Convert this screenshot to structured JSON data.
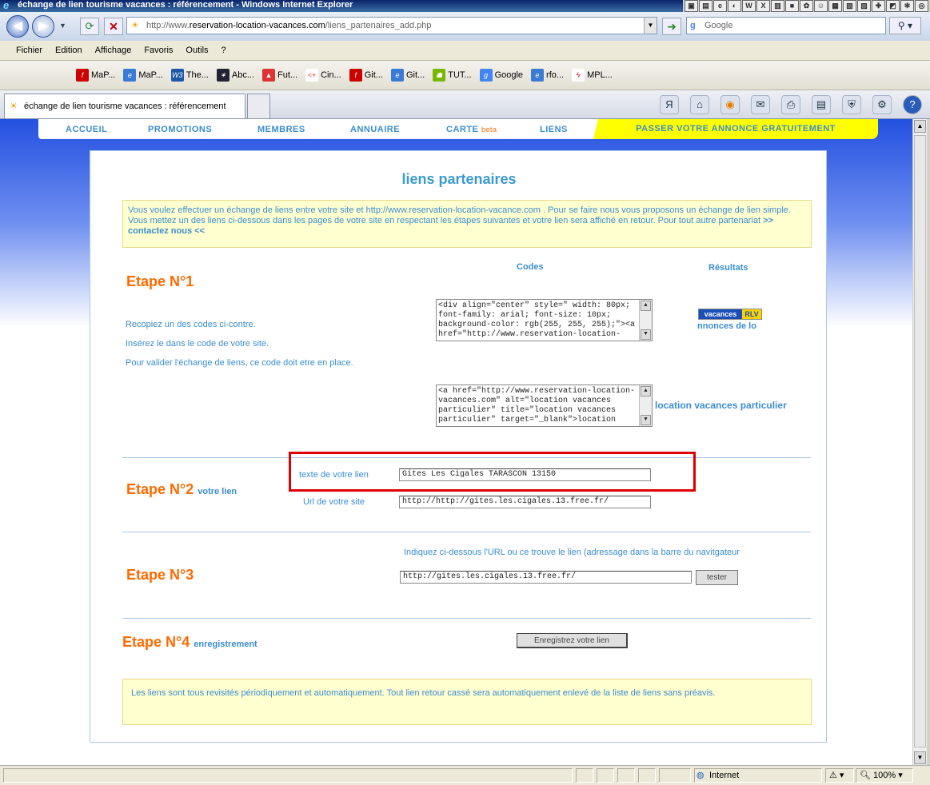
{
  "window": {
    "title": "échange de lien tourisme vacances : référencement - Windows Internet Explorer"
  },
  "address": {
    "prefix": "http://www.",
    "domain": "reservation-location-vacances.com",
    "path": "/liens_partenaires_add.php",
    "search_placeholder": "Google"
  },
  "menu": [
    "Fichier",
    "Edition",
    "Affichage",
    "Favoris",
    "Outils",
    "?"
  ],
  "favorites": [
    "MaP...",
    "MaP...",
    "The...",
    "Abc...",
    "Fut...",
    "Cin...",
    "Git...",
    "Git...",
    "TUT...",
    "Google",
    "rfo...",
    "MPL..."
  ],
  "tab": {
    "title": "échange de lien tourisme vacances : référencement"
  },
  "sitenav": {
    "items": [
      "ACCUEIL",
      "PROMOTIONS",
      "MEMBRES",
      "ANNUAIRE",
      "CARTE",
      "LIENS"
    ],
    "carte_beta": "beta",
    "cta": "PASSER VOTRE ANNONCE GRATUITEMENT"
  },
  "main": {
    "title": "liens partenaires",
    "intro": "Vous voulez effectuer un échange de liens entre votre site et http://www.reservation-location-vacance.com . Pour se faire nous vous proposons un échange de lien simple. Vous mettez un des liens ci-dessous dans les pages de votre site en respectant les étapes suivantes et votre lien sera affiché en retour. Pour tout autre partenariat",
    "intro_link": ">> contactez nous <<",
    "codes_header": "Codes",
    "results_header": "Résultats",
    "etape1": "Etape N°1",
    "etape1_lines": [
      "Recopiez un des codes ci-contre.",
      "Insérez le dans le code de votre site.",
      "Pour valider l'échange de liens, ce code doit etre en place."
    ],
    "code1": "<div align=\"center\" style=\" width: 80px; font-family: arial; font-size: 10px; background-color: rgb(255, 255, 255);\"><a href=\"http://www.reservation-location-",
    "code2": "<a href=\"http://www.reservation-location-vacances.com\" alt=\"location vacances particulier\" title=\"location vacances particulier\" target=\"_blank\">location",
    "badge_left": "vacances",
    "badge_right": "RLV",
    "result1_text": "nnonces de lo",
    "result2_text": "location vacances particulier",
    "etape2": "Etape N°2",
    "etape2_sub": "votre lien",
    "label_texte": "texte de votre lien",
    "value_texte": "Gites Les Cigales TARASCON 13150",
    "label_url": "Url de votre site",
    "value_url": "http://http://gites.les.cigales.13.free.fr/",
    "etape3": "Etape N°3",
    "etape3_hint": "Indiquez ci-dessous l'URL ou ce trouve le lien (adressage dans la barre du navitgateur",
    "value_backlink": "http://gites.les.cigales.13.free.fr/",
    "tester": "tester",
    "etape4": "Etape N°4",
    "etape4_sub": "enregistrement",
    "submit": "Enregistrez votre lien",
    "footer_note": "Les liens sont tous revisités périodiquement et automatiquement. Tout lien retour cassé sera automatiquement enlevé de la liste de liens sans préavis."
  },
  "status": {
    "zone": "Internet",
    "zoom": "100%"
  },
  "colors": {
    "accent_blue": "#3b8dd0",
    "etape_orange": "#ff6a00",
    "highlight_red": "#e00000",
    "cta_yellow": "#ffff00"
  }
}
